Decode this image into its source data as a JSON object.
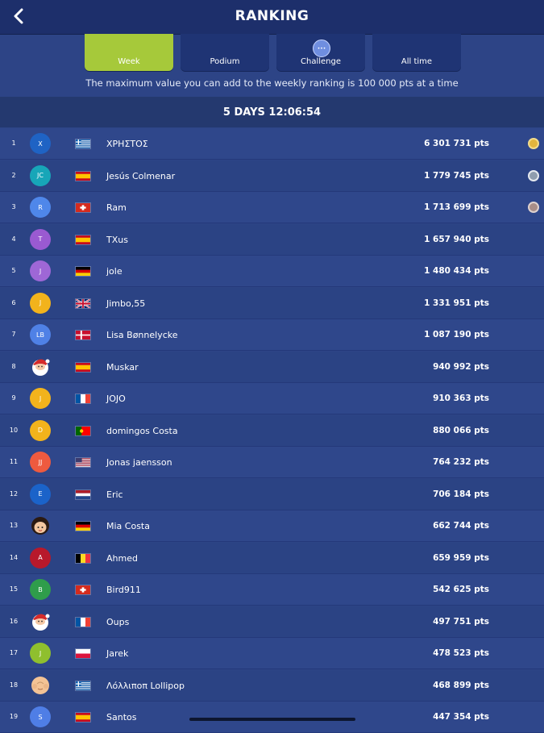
{
  "header": {
    "title": "RANKING",
    "back_icon": "chevron-left-icon"
  },
  "tabs": [
    {
      "label": "Week",
      "active": true
    },
    {
      "label": "Podium",
      "active": false
    },
    {
      "label": "Challenge",
      "active": false,
      "badge": "•••"
    },
    {
      "label": "All time",
      "active": false
    }
  ],
  "notice": "The maximum value you can add to the weekly ranking is 100 000 pts at a time",
  "timer": "5 DAYS 12:06:54",
  "colors": {
    "active_tab": "#a6c93a",
    "header_bg": "#1d2f6b",
    "list_bg": "#2d4486"
  },
  "ranking": [
    {
      "rank": "1",
      "initials": "X",
      "avatar_color": "#1f63c4",
      "avatar_type": "initials",
      "flag": "gr",
      "name": "ΧΡΗΣΤΟΣ",
      "score": "6 301 731 pts",
      "medal": "gold"
    },
    {
      "rank": "2",
      "initials": "JC",
      "avatar_color": "#17a6b8",
      "avatar_type": "initials",
      "flag": "es",
      "name": "Jesús Colmenar",
      "score": "1 779 745 pts",
      "medal": "silver"
    },
    {
      "rank": "3",
      "initials": "R",
      "avatar_color": "#4f87ea",
      "avatar_type": "initials",
      "flag": "ch",
      "name": "Ram",
      "score": "1 713 699 pts",
      "medal": "bronze"
    },
    {
      "rank": "4",
      "initials": "T",
      "avatar_color": "#9a5ad1",
      "avatar_type": "initials",
      "flag": "es",
      "name": "TXus",
      "score": "1 657 940 pts",
      "medal": ""
    },
    {
      "rank": "5",
      "initials": "J",
      "avatar_color": "#9e67d6",
      "avatar_type": "initials",
      "flag": "de",
      "name": "jole",
      "score": "1 480 434 pts",
      "medal": ""
    },
    {
      "rank": "6",
      "initials": "J",
      "avatar_color": "#f2b31c",
      "avatar_type": "initials",
      "flag": "gb",
      "name": "Jimbo,55",
      "score": "1 331 951 pts",
      "medal": ""
    },
    {
      "rank": "7",
      "initials": "LB",
      "avatar_color": "#4f81e6",
      "avatar_type": "initials",
      "flag": "dk",
      "name": "Lisa Bønnelycke",
      "score": "1 087 190 pts",
      "medal": ""
    },
    {
      "rank": "8",
      "initials": "",
      "avatar_color": "",
      "avatar_type": "santa",
      "flag": "es",
      "name": "Muskar",
      "score": "940 992 pts",
      "medal": ""
    },
    {
      "rank": "9",
      "initials": "J",
      "avatar_color": "#f2b31c",
      "avatar_type": "initials",
      "flag": "fr",
      "name": "JOJO",
      "score": "910 363 pts",
      "medal": ""
    },
    {
      "rank": "10",
      "initials": "D",
      "avatar_color": "#f2b31c",
      "avatar_type": "initials",
      "flag": "pt",
      "name": "domingos Costa",
      "score": "880 066 pts",
      "medal": ""
    },
    {
      "rank": "11",
      "initials": "JJ",
      "avatar_color": "#ee5a3f",
      "avatar_type": "initials",
      "flag": "us",
      "name": "Jonas jaensson",
      "score": "764 232 pts",
      "medal": ""
    },
    {
      "rank": "12",
      "initials": "E",
      "avatar_color": "#1b63c9",
      "avatar_type": "initials",
      "flag": "nl",
      "name": "Eric",
      "score": "706 184 pts",
      "medal": ""
    },
    {
      "rank": "13",
      "initials": "",
      "avatar_color": "",
      "avatar_type": "girl",
      "flag": "de",
      "name": "Mia Costa",
      "score": "662 744 pts",
      "medal": ""
    },
    {
      "rank": "14",
      "initials": "A",
      "avatar_color": "#b8192b",
      "avatar_type": "initials",
      "flag": "be",
      "name": "Ahmed",
      "score": "659 959 pts",
      "medal": ""
    },
    {
      "rank": "15",
      "initials": "B",
      "avatar_color": "#2f9d4b",
      "avatar_type": "initials",
      "flag": "ch",
      "name": "Bird911",
      "score": "542 625 pts",
      "medal": ""
    },
    {
      "rank": "16",
      "initials": "",
      "avatar_color": "",
      "avatar_type": "santa",
      "flag": "fr",
      "name": "Oups",
      "score": "497 751 pts",
      "medal": ""
    },
    {
      "rank": "17",
      "initials": "J",
      "avatar_color": "#8fbf2e",
      "avatar_type": "initials",
      "flag": "pl",
      "name": "Jarek",
      "score": "478 523 pts",
      "medal": ""
    },
    {
      "rank": "18",
      "initials": "",
      "avatar_color": "",
      "avatar_type": "baby",
      "flag": "gr",
      "name": "Λόλλιποπ Lollipop",
      "score": "468 899 pts",
      "medal": ""
    },
    {
      "rank": "19",
      "initials": "S",
      "avatar_color": "#4f7ee6",
      "avatar_type": "initials",
      "flag": "es",
      "name": "Santos",
      "score": "447 354 pts",
      "medal": ""
    }
  ]
}
